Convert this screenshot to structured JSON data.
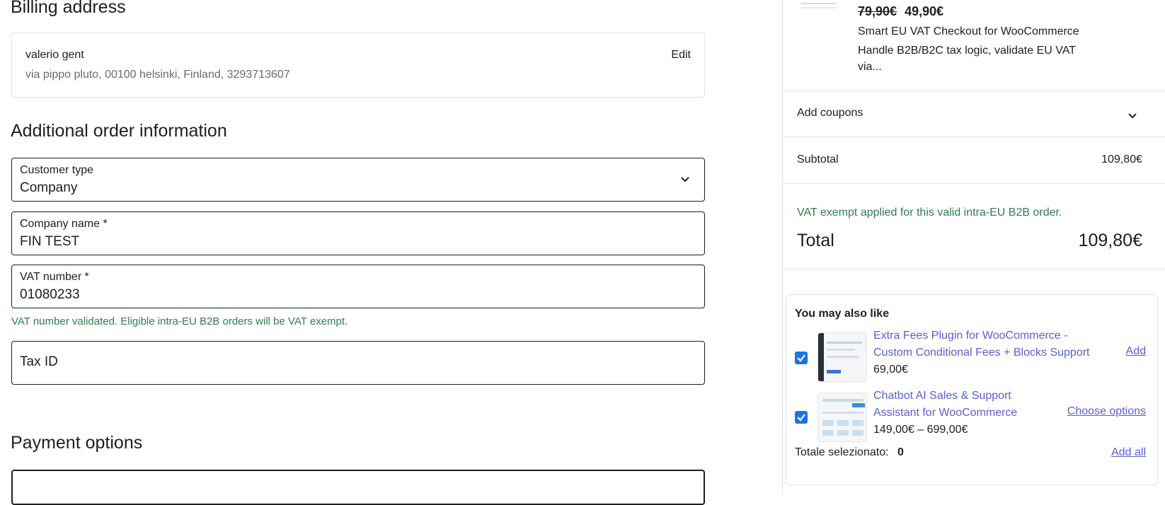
{
  "billing": {
    "heading": "Billing address",
    "name": "valerio gent",
    "address": "via pippo pluto, 00100 helsinki, Finland, 3293713607",
    "edit_label": "Edit"
  },
  "additional": {
    "heading": "Additional order information",
    "customer_type": {
      "label": "Customer type",
      "value": "Company"
    },
    "company_name": {
      "label": "Company name *",
      "value": "FIN TEST"
    },
    "vat_number": {
      "label": "VAT number *",
      "value": "01080233"
    },
    "vat_message": "VAT number validated. Eligible intra-EU B2B orders will be VAT exempt.",
    "tax_id": {
      "label": "Tax ID",
      "value": ""
    }
  },
  "payment": {
    "heading": "Payment options"
  },
  "order_item": {
    "old_price": "79,90€",
    "new_price": "49,90€",
    "title": "Smart EU VAT Checkout for WooCommerce",
    "desc_line1": "Handle B2B/B2C tax logic, validate EU VAT",
    "desc_line2": "via..."
  },
  "coupons": {
    "label": "Add coupons"
  },
  "subtotal": {
    "label": "Subtotal",
    "value": "109,80€"
  },
  "vat_exempt_note": "VAT exempt applied for this valid intra-EU B2B order.",
  "total": {
    "label": "Total",
    "value": "109,80€"
  },
  "upsell": {
    "heading": "You may also like",
    "items": [
      {
        "title_line1": "Extra Fees Plugin for WooCommerce -",
        "title_line2": "Custom Conditional Fees + Blocks Support",
        "price": "69,00€",
        "action": "Add",
        "checked": true
      },
      {
        "title_line1": "Chatbot AI Sales & Support",
        "title_line2": "Assistant for WooCommerce",
        "price": "149,00€ – 699,00€",
        "action": "Choose options",
        "checked": true
      }
    ],
    "selected_total_label": "Totale selezionato:",
    "selected_total_value": "0",
    "add_all_label": "Add all"
  },
  "colors": {
    "accent_link": "#5a5fcf",
    "success_green": "#2e7d4f",
    "checkbox_blue": "#1a73e8"
  }
}
